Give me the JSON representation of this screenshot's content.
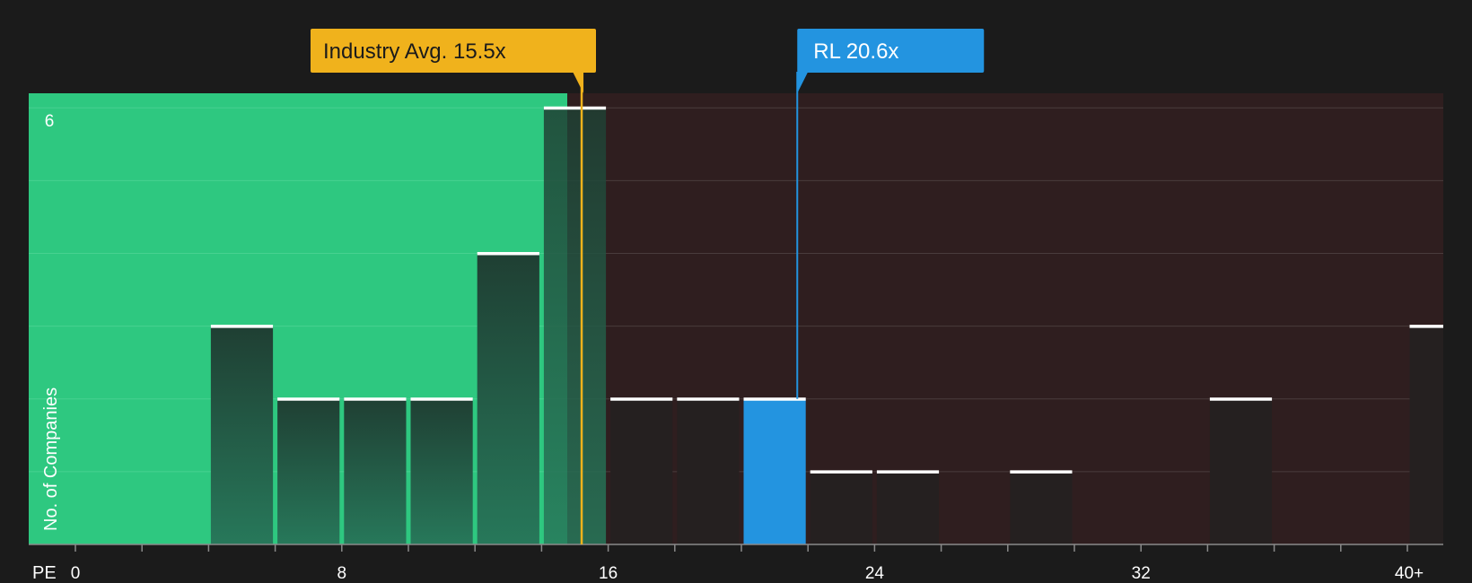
{
  "chart_data": {
    "type": "bar",
    "title": "",
    "xlabel": "PE",
    "ylabel": "No. of Companies",
    "x_ticks": [
      "0",
      "8",
      "16",
      "24",
      "32",
      "40+"
    ],
    "x_tick_values": [
      0,
      8,
      16,
      24,
      32,
      40
    ],
    "xlim": [
      0,
      41.0
    ],
    "y_ticks": [
      "6"
    ],
    "y_tick_values": [
      6
    ],
    "ylim": [
      0,
      6.2
    ],
    "bin_width": 2,
    "bins": [
      {
        "start": 0,
        "value": 0
      },
      {
        "start": 4,
        "value": 3
      },
      {
        "start": 6,
        "value": 2
      },
      {
        "start": 8,
        "value": 2
      },
      {
        "start": 10,
        "value": 2
      },
      {
        "start": 12,
        "value": 4
      },
      {
        "start": 14,
        "value": 6
      },
      {
        "start": 16,
        "value": 2
      },
      {
        "start": 18,
        "value": 2
      },
      {
        "start": 20,
        "value": 2,
        "highlight": true
      },
      {
        "start": 22,
        "value": 1
      },
      {
        "start": 24,
        "value": 1
      },
      {
        "start": 28,
        "value": 1
      },
      {
        "start": 34,
        "value": 2
      },
      {
        "start": 40,
        "value": 3
      }
    ],
    "industry_avg": {
      "label": "Industry Avg. 15.5x",
      "value": 15.5,
      "color": "#f0b21c"
    },
    "company": {
      "label": "RL 20.6x",
      "value": 20.6,
      "color": "#2394e0"
    },
    "grid": true,
    "colors": {
      "background": "#1b1b1b",
      "undervalued_region": "#2ec880",
      "overvalued_region": "#2f1e1f",
      "bar_dark": "#1d3a2f",
      "bar_neutral": "#252020",
      "bar_cap": "#ffffff",
      "highlight_bar": "#2394e0"
    }
  }
}
